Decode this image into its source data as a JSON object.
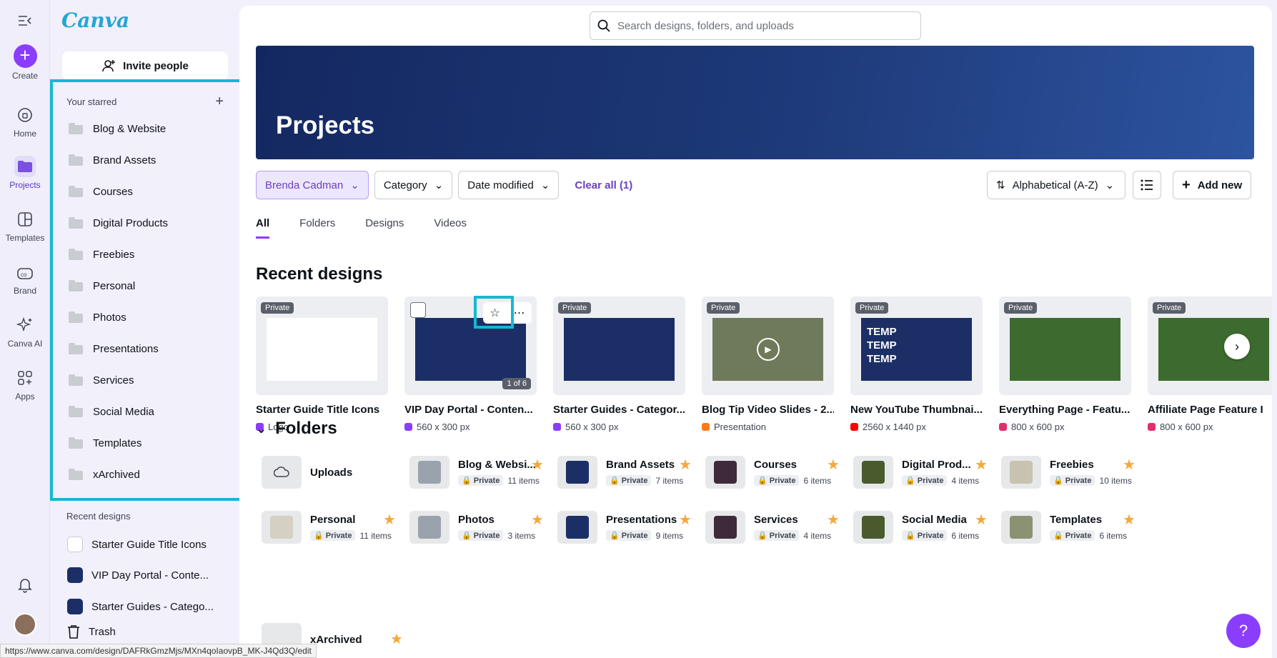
{
  "app": {
    "logo": "Canva"
  },
  "rail": {
    "items": [
      {
        "label": "Create"
      },
      {
        "label": "Home"
      },
      {
        "label": "Projects"
      },
      {
        "label": "Templates"
      },
      {
        "label": "Brand"
      },
      {
        "label": "Canva AI"
      },
      {
        "label": "Apps"
      }
    ]
  },
  "panel": {
    "invite_label": "Invite people",
    "starred_label": "Your starred",
    "starred": [
      "Blog & Website",
      "Brand Assets",
      "Courses",
      "Digital Products",
      "Freebies",
      "Personal",
      "Photos",
      "Presentations",
      "Services",
      "Social Media",
      "Templates",
      "xArchived"
    ],
    "recent_label": "Recent designs",
    "recent": [
      "Starter Guide Title Icons",
      "VIP Day Portal - Conte...",
      "Starter Guides - Catego..."
    ],
    "trash_label": "Trash"
  },
  "search": {
    "placeholder": "Search designs, folders, and uploads"
  },
  "hero": {
    "title": "Projects"
  },
  "filters": {
    "owner": "Brenda Cadman",
    "category": "Category",
    "date": "Date modified",
    "clear": "Clear all (1)",
    "sort": "Alphabetical (A-Z)",
    "add_new": "Add new"
  },
  "tabs": [
    "All",
    "Folders",
    "Designs",
    "Videos"
  ],
  "recent_designs": {
    "heading": "Recent designs",
    "private": "Private",
    "page_count": "1 of 6",
    "items": [
      {
        "title": "Starter Guide Title Icons",
        "sub": "Logo",
        "color": "#8b3dff"
      },
      {
        "title": "VIP Day Portal - Conten...",
        "sub": "560 x 300 px",
        "color": "#8b3dff"
      },
      {
        "title": "Starter Guides - Categor...",
        "sub": "560 x 300 px",
        "color": "#8b3dff"
      },
      {
        "title": "Blog Tip Video Slides - 2...",
        "sub": "Presentation",
        "color": "#ff7a1a"
      },
      {
        "title": "New YouTube Thumbnai...",
        "sub": "2560 x 1440 px",
        "color": "#ff0000"
      },
      {
        "title": "Everything Page - Featu...",
        "sub": "800 x 600 px",
        "color": "#e1306c"
      },
      {
        "title": "Affiliate Page Feature I",
        "sub": "800 x 600 px",
        "color": "#e1306c"
      }
    ],
    "thumb_text": "TEMP TEMP TEMP"
  },
  "folders": {
    "heading": "Folders",
    "private": "Private",
    "uploads": "Uploads",
    "items": [
      {
        "name": "Blog & Websi...",
        "count": "11 items",
        "color": "#9aa2ad"
      },
      {
        "name": "Brand Assets",
        "count": "7 items",
        "color": "#1b2f66"
      },
      {
        "name": "Courses",
        "count": "6 items",
        "color": "#3f2a3a"
      },
      {
        "name": "Digital Prod...",
        "count": "4 items",
        "color": "#4b5a2c"
      },
      {
        "name": "Freebies",
        "count": "10 items",
        "color": "#c8c2b0"
      },
      {
        "name": "Personal",
        "count": "11 items",
        "color": "#d4d0c2"
      },
      {
        "name": "Photos",
        "count": "3 items",
        "color": "#9aa2ad"
      },
      {
        "name": "Presentations",
        "count": "9 items",
        "color": "#1b2f66"
      },
      {
        "name": "Services",
        "count": "4 items",
        "color": "#3f2a3a"
      },
      {
        "name": "Social Media",
        "count": "6 items",
        "color": "#4b5a2c"
      },
      {
        "name": "Templates",
        "count": "6 items",
        "color": "#8a9273"
      }
    ],
    "archived": "xArchived"
  },
  "help_label": "?",
  "status_url": "https://www.canva.com/design/DAFRkGmzMjs/MXn4qoIaovpB_MK-J4Qd3Q/edit"
}
